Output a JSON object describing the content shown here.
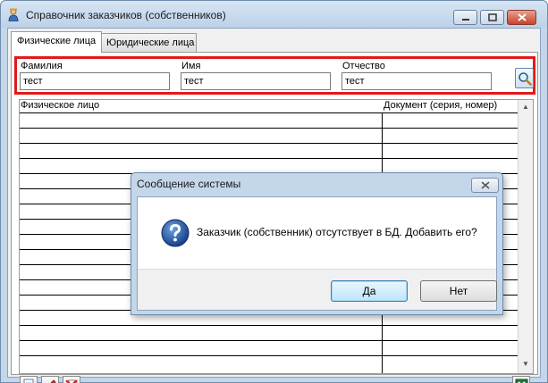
{
  "window": {
    "title": "Справочник заказчиков (собственников)"
  },
  "tabs": [
    {
      "label": "Физические лица",
      "active": true
    },
    {
      "label": "Юридические лица",
      "active": false
    }
  ],
  "filter": {
    "last_name_label": "Фамилия",
    "last_name_value": "тест",
    "first_name_label": "Имя",
    "first_name_value": "тест",
    "patronymic_label": "Отчество",
    "patronymic_value": "тест"
  },
  "grid": {
    "columns": [
      "Физическое лицо",
      "Документ (серия, номер)"
    ],
    "rows": []
  },
  "dialog": {
    "title": "Сообщение системы",
    "message": "Заказчик (собственник) отсутствует в БД. Добавить его?",
    "yes_label": "Да",
    "no_label": "Нет"
  },
  "colors": {
    "highlight_frame": "#e01a1a",
    "annotation_arrow": "#e01a1a",
    "window_frame": "#c4d6ea"
  }
}
